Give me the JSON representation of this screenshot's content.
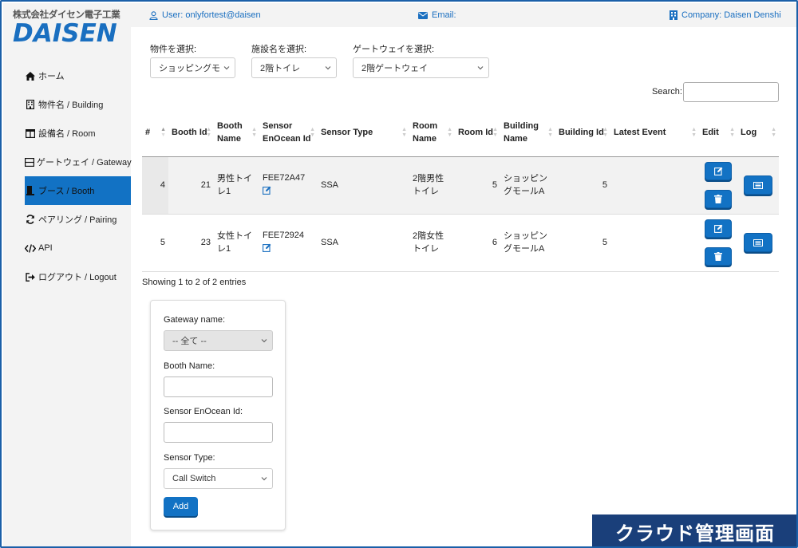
{
  "brand": {
    "jp": "株式会社ダイセン電子工業",
    "en": "DAISEN"
  },
  "topbar": {
    "user": "User: onlyfortest@daisen",
    "email": "Email:",
    "company": "Company: Daisen Denshi"
  },
  "sidebar": {
    "items": [
      {
        "label": "ホーム",
        "icon": "home-icon"
      },
      {
        "label": "物件名 / Building",
        "icon": "building-icon"
      },
      {
        "label": "設備名 / Room",
        "icon": "room-icon"
      },
      {
        "label": "ゲートウェイ / Gateway",
        "icon": "gateway-icon"
      },
      {
        "label": "ブース / Booth",
        "icon": "booth-icon",
        "active": true
      },
      {
        "label": "ペアリング / Pairing",
        "icon": "sync-icon"
      },
      {
        "label": "API",
        "icon": "code-icon"
      },
      {
        "label": "ログアウト / Logout",
        "icon": "logout-icon"
      }
    ]
  },
  "filters": {
    "property": {
      "label": "物件を選択:",
      "value": "ショッピングモ"
    },
    "facility": {
      "label": "施設名を選択:",
      "value": "2階トイレ"
    },
    "gateway": {
      "label": "ゲートウェイを選択:",
      "value": "2階ゲートウェイ"
    }
  },
  "search": {
    "label": "Search:"
  },
  "table": {
    "headers": {
      "num": "#",
      "booth_id": "Booth Id",
      "booth_name": "Booth Name",
      "sensor_id": "Sensor EnOcean Id",
      "sensor_type": "Sensor Type",
      "room_name": "Room Name",
      "room_id": "Room Id",
      "building_name": "Building Name",
      "building_id": "Building Id",
      "latest_event": "Latest Event",
      "edit": "Edit",
      "log": "Log"
    },
    "rows": [
      {
        "num": "4",
        "booth_id": "21",
        "booth_name": "男性トイレ1",
        "sensor_id": "FEE72A47",
        "sensor_type": "SSA",
        "room_name": "2階男性トイレ",
        "room_id": "5",
        "building_name": "ショッピングモールA",
        "building_id": "5",
        "latest_event": ""
      },
      {
        "num": "5",
        "booth_id": "23",
        "booth_name": "女性トイレ1",
        "sensor_id": "FEE72924",
        "sensor_type": "SSA",
        "room_name": "2階女性トイレ",
        "room_id": "6",
        "building_name": "ショッピングモールA",
        "building_id": "5",
        "latest_event": ""
      }
    ],
    "info": "Showing 1 to 2 of 2 entries"
  },
  "form": {
    "gateway_label": "Gateway name:",
    "gateway_value": "-- 全て --",
    "booth_label": "Booth Name:",
    "sensor_id_label": "Sensor EnOcean Id:",
    "sensor_type_label": "Sensor Type:",
    "sensor_type_value": "Call Switch",
    "add_label": "Add"
  },
  "banner": "クラウド管理画面",
  "colors": {
    "accent": "#1272c4",
    "link": "#1a6fc0",
    "banner": "#1a3f7a"
  }
}
